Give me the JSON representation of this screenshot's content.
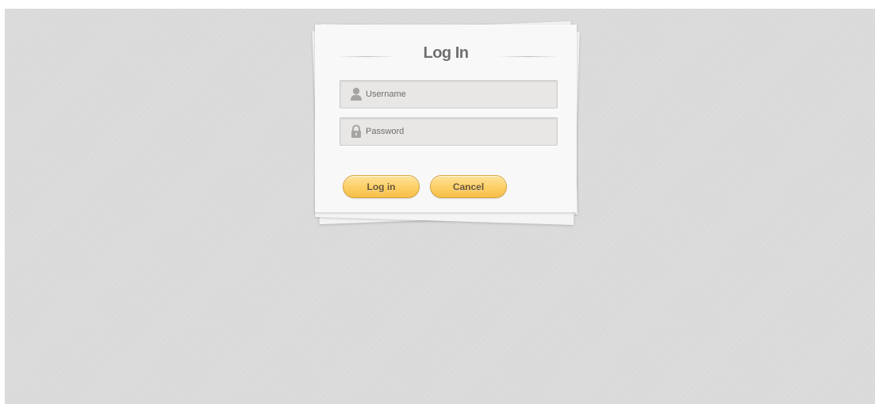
{
  "form": {
    "title": "Log In",
    "username": {
      "placeholder": "Username",
      "value": "",
      "icon": "user-icon"
    },
    "password": {
      "placeholder": "Password",
      "value": "",
      "icon": "lock-icon"
    },
    "buttons": {
      "login_label": "Log in",
      "cancel_label": "Cancel"
    }
  },
  "colors": {
    "background": "#dcdcdc",
    "card": "#f8f8f8",
    "field": "#e9e7e6",
    "button_top": "#fde29a",
    "button_bottom": "#f6bf49",
    "title_text": "#6f6f6f"
  }
}
